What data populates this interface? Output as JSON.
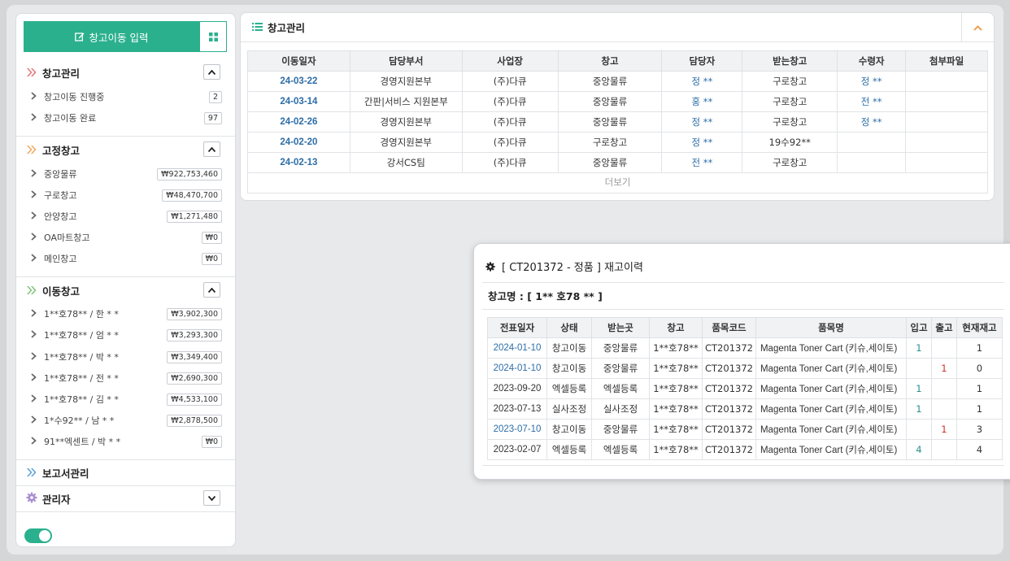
{
  "sidebar": {
    "input_button": "창고이동 입력",
    "sections": {
      "warehouse_mgmt": {
        "title": "창고관리",
        "items": [
          {
            "label": "창고이동 진행중",
            "badge": "2"
          },
          {
            "label": "창고이동 완료",
            "badge": "97"
          }
        ]
      },
      "fixed": {
        "title": "고정창고",
        "items": [
          {
            "label": "중앙물류",
            "badge": "₩922,753,460"
          },
          {
            "label": "구로창고",
            "badge": "₩48,470,700"
          },
          {
            "label": "안양창고",
            "badge": "₩1,271,480"
          },
          {
            "label": "OA마트창고",
            "badge": "₩0"
          },
          {
            "label": "메인창고",
            "badge": "₩0"
          }
        ]
      },
      "mobile": {
        "title": "이동창고",
        "items": [
          {
            "label": "1**호78** / 한 * *",
            "badge": "₩3,902,300"
          },
          {
            "label": "1**호78** / 엄 * *",
            "badge": "₩3,293,300"
          },
          {
            "label": "1**호78** / 박 * *",
            "badge": "₩3,349,400"
          },
          {
            "label": "1**호78** / 전 * *",
            "badge": "₩2,690,300"
          },
          {
            "label": "1**호78** / 김 * *",
            "badge": "₩4,533,100"
          },
          {
            "label": "1*수92** / 남 * *",
            "badge": "₩2,878,500"
          },
          {
            "label": "91**엑센트 / 박 * *",
            "badge": "₩0"
          }
        ]
      },
      "report": {
        "title": "보고서관리"
      },
      "admin": {
        "title": "관리자"
      }
    }
  },
  "panel": {
    "title": "창고관리",
    "columns": [
      "이동일자",
      "담당부서",
      "사업장",
      "창고",
      "담당자",
      "받는창고",
      "수령자",
      "첨부파일"
    ],
    "rows": [
      {
        "date": "24-03-22",
        "dept": "경영지원본부",
        "site": "(주)다큐",
        "wh": "중앙물류",
        "person": "정 **",
        "to": "구로창고",
        "recv": "정 **",
        "file": ""
      },
      {
        "date": "24-03-14",
        "dept": "간판|서비스 지원본부",
        "site": "(주)다큐",
        "wh": "중앙물류",
        "person": "홍 **",
        "to": "구로창고",
        "recv": "전 **",
        "file": ""
      },
      {
        "date": "24-02-26",
        "dept": "경영지원본부",
        "site": "(주)다큐",
        "wh": "중앙물류",
        "person": "정 **",
        "to": "구로창고",
        "recv": "정 **",
        "file": ""
      },
      {
        "date": "24-02-20",
        "dept": "경영지원본부",
        "site": "(주)다큐",
        "wh": "구로창고",
        "person": "정 **",
        "to": "19수92**",
        "recv": "",
        "file": ""
      },
      {
        "date": "24-02-13",
        "dept": "강서CS팀",
        "site": "(주)다큐",
        "wh": "중앙물류",
        "person": "전 **",
        "to": "구로창고",
        "recv": "",
        "file": ""
      }
    ],
    "more": "더보기"
  },
  "modal": {
    "title": "[ CT201372 - 정품 ] 재고이력",
    "warehouse_label": "창고명 : [ 1** 호78 ** ]",
    "columns": [
      "전표일자",
      "상태",
      "받는곳",
      "창고",
      "품목코드",
      "품목명",
      "입고",
      "출고",
      "현재재고"
    ],
    "rows": [
      {
        "date": "2024-01-10",
        "link": true,
        "status": "창고이동",
        "to": "중앙물류",
        "wh": "1**호78**",
        "code": "CT201372",
        "name": "Magenta Toner Cart (키슈,세이토)",
        "in": "1",
        "out": "",
        "stock": "1"
      },
      {
        "date": "2024-01-10",
        "link": true,
        "status": "창고이동",
        "to": "중앙물류",
        "wh": "1**호78**",
        "code": "CT201372",
        "name": "Magenta Toner Cart (키슈,세이토)",
        "in": "",
        "out": "1",
        "stock": "0"
      },
      {
        "date": "2023-09-20",
        "link": false,
        "status": "엑셀등록",
        "to": "엑셀등록",
        "wh": "1**호78**",
        "code": "CT201372",
        "name": "Magenta Toner Cart (키슈,세이토)",
        "in": "1",
        "out": "",
        "stock": "1"
      },
      {
        "date": "2023-07-13",
        "link": false,
        "status": "실사조정",
        "to": "실사조정",
        "wh": "1**호78**",
        "code": "CT201372",
        "name": "Magenta Toner Cart (키슈,세이토)",
        "in": "1",
        "out": "",
        "stock": "1"
      },
      {
        "date": "2023-07-10",
        "link": true,
        "status": "창고이동",
        "to": "중앙물류",
        "wh": "1**호78**",
        "code": "CT201372",
        "name": "Magenta Toner Cart (키슈,세이토)",
        "in": "",
        "out": "1",
        "stock": "3"
      },
      {
        "date": "2023-02-07",
        "link": false,
        "status": "엑셀등록",
        "to": "엑셀등록",
        "wh": "1**호78**",
        "code": "CT201372",
        "name": "Magenta Toner Cart (키슈,세이토)",
        "in": "4",
        "out": "",
        "stock": "4"
      }
    ]
  },
  "colors": {
    "accent": "#2bb08e",
    "link": "#2d6da8",
    "in": "#2a8e8e",
    "out": "#d0312d"
  },
  "icons": [
    "edit-icon",
    "grid-icon",
    "double-chevron-icon",
    "gear-icon",
    "list-icon",
    "chevron-up-icon",
    "chevron-down-icon",
    "chevron-right-icon",
    "toggle-switch"
  ]
}
